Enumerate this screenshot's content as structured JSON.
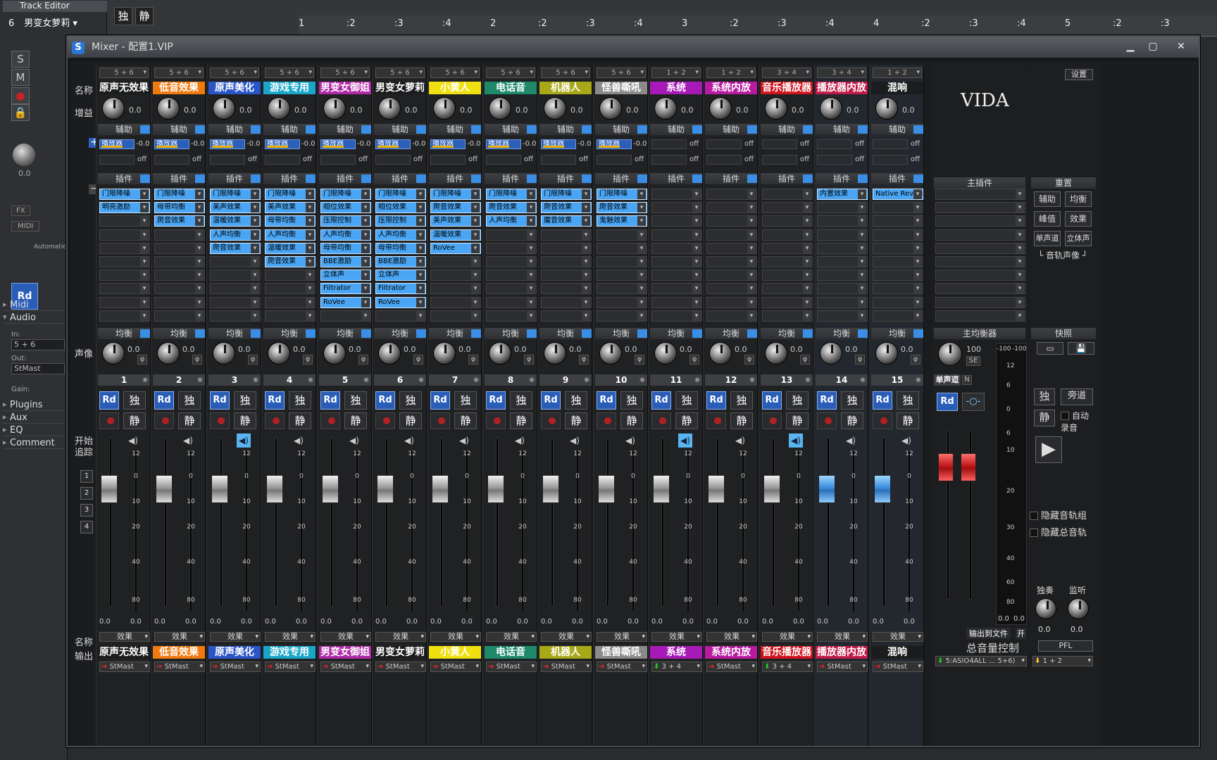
{
  "track_editor": {
    "title": "Track Editor",
    "track_num": "6",
    "track_name": "男变女萝莉",
    "solo": "独",
    "mute": "静"
  },
  "ruler": {
    "ticks": [
      "1",
      ":2",
      ":3",
      ":4",
      "2",
      ":2",
      ":3",
      ":4",
      "3",
      ":2",
      ":3",
      ":4",
      "4",
      ":2",
      ":3",
      ":4",
      "5",
      ":2",
      ":3"
    ]
  },
  "left_panel": {
    "btn_s": "S",
    "btn_m": "M",
    "knob_value": "0.0",
    "fx": "FX",
    "midi": "MIDI",
    "automation": "Automation",
    "rd": "Rd",
    "sections": [
      "Midi",
      "Audio",
      "Plugins",
      "Aux",
      "EQ",
      "Comment"
    ],
    "in_label": "In:",
    "in_value": "5 + 6",
    "out_label": "Out:",
    "out_value": "StMast",
    "gain_label": "Gain:"
  },
  "mixer": {
    "title": "Mixer - 配置1.VIP",
    "row_labels": {
      "name": "名称",
      "gain": "增益",
      "pan": "声像",
      "start": "开始",
      "track": "追踪",
      "name2": "名称",
      "output": "输出"
    },
    "section_labels": {
      "aux": "辅助",
      "insert": "插件",
      "eq": "均衡",
      "fx": "效果",
      "off": "off"
    },
    "track_btns": [
      "1",
      "2",
      "3",
      "4"
    ],
    "channels": [
      {
        "num": "1",
        "route": "5 + 6",
        "name": "原声无效果",
        "color": "#1b1c1e",
        "gain": "0.0",
        "pan": "0.0",
        "send": "播放器",
        "send_val": "-0.0",
        "inserts": [
          "门限降噪",
          "明亮激励"
        ],
        "speaker_on": false,
        "fader": 0.62,
        "output": "StMast",
        "out_arrow": "red"
      },
      {
        "num": "2",
        "route": "5 + 6",
        "name": "低音效果",
        "color": "#f07a10",
        "gain": "0.0",
        "pan": "0.0",
        "send": "播放器",
        "send_val": "-0.0",
        "inserts": [
          "门限降噪",
          "母带均衡",
          "爬音效果"
        ],
        "speaker_on": false,
        "fader": 0.62,
        "output": "StMast",
        "out_arrow": "red"
      },
      {
        "num": "3",
        "route": "5 + 6",
        "name": "原声美化",
        "color": "#2a56c8",
        "gain": "0.0",
        "pan": "0.0",
        "send": "播放器",
        "send_val": "-0.0",
        "inserts": [
          "门限降噪",
          "美声效果",
          "温暖效果",
          "人声均衡",
          "爬音效果"
        ],
        "speaker_on": true,
        "fader": 0.62,
        "output": "StMast",
        "out_arrow": "red"
      },
      {
        "num": "4",
        "route": "5 + 6",
        "name": "游戏专用",
        "color": "#1aa6c8",
        "gain": "0.0",
        "pan": "0.0",
        "send": "播放器",
        "send_val": "-0.0",
        "inserts": [
          "门限降噪",
          "美声效果",
          "母带均衡",
          "人声均衡",
          "温暖效果",
          "爬音效果"
        ],
        "speaker_on": false,
        "fader": 0.62,
        "output": "StMast",
        "out_arrow": "red"
      },
      {
        "num": "5",
        "route": "5 + 6",
        "name": "男变女御姐",
        "color": "#b02aa8",
        "gain": "0.0",
        "pan": "0.0",
        "send": "播放器",
        "send_val": "-0.0",
        "inserts": [
          "门限降噪",
          "相位效果",
          "压限控制",
          "人声均衡",
          "母带均衡",
          "BBE激励",
          "立体声",
          "Filtrator",
          "RoVee"
        ],
        "speaker_on": false,
        "fader": 0.62,
        "output": "StMast",
        "out_arrow": "red"
      },
      {
        "num": "6",
        "route": "5 + 6",
        "name": "男变女萝莉",
        "color": "#1b1c1e",
        "gain": "0.0",
        "pan": "0.0",
        "send": "播放器",
        "send_val": "-0.0",
        "inserts": [
          "门限降噪",
          "相位效果",
          "压限控制",
          "人声均衡",
          "母带均衡",
          "BBE激励",
          "立体声",
          "Filtrator",
          "RoVee"
        ],
        "speaker_on": false,
        "fader": 0.62,
        "output": "StMast",
        "out_arrow": "red"
      },
      {
        "num": "7",
        "route": "5 + 6",
        "name": "小黄人",
        "color": "#f0e010",
        "gain": "0.0",
        "pan": "0.0",
        "send": "播放器",
        "send_val": "-0.0",
        "inserts": [
          "门限降噪",
          "爬音效果",
          "美声效果",
          "温暖效果",
          "RoVee"
        ],
        "speaker_on": false,
        "fader": 0.62,
        "output": "StMast",
        "out_arrow": "red"
      },
      {
        "num": "8",
        "route": "5 + 6",
        "name": "电话音",
        "color": "#1e8a6a",
        "gain": "0.0",
        "pan": "0.0",
        "send": "播放器",
        "send_val": "-0.0",
        "inserts": [
          "门限降噪",
          "爬音效果",
          "人声均衡"
        ],
        "speaker_on": false,
        "fader": 0.62,
        "output": "StMast",
        "out_arrow": "red"
      },
      {
        "num": "9",
        "route": "5 + 6",
        "name": "机器人",
        "color": "#a8a818",
        "gain": "0.0",
        "pan": "0.0",
        "send": "播放器",
        "send_val": "-0.0",
        "inserts": [
          "门限降噪",
          "爬音效果",
          "魔音效果"
        ],
        "speaker_on": false,
        "fader": 0.62,
        "output": "StMast",
        "out_arrow": "red"
      },
      {
        "num": "10",
        "route": "5 + 6",
        "name": "怪兽嘶吼",
        "color": "#8a8a8a",
        "gain": "0.0",
        "pan": "0.0",
        "send": "播放器",
        "send_val": "-0.0",
        "inserts": [
          "门限降噪",
          "爬音效果",
          "鬼魅效果"
        ],
        "speaker_on": false,
        "fader": 0.62,
        "output": "StMast",
        "out_arrow": "red"
      },
      {
        "num": "11",
        "route": "1 + 2",
        "name": "系统",
        "color": "#a81ab8",
        "gain": "0.0",
        "pan": "0.0",
        "send": "",
        "send_val": "off",
        "inserts": [],
        "speaker_on": true,
        "fader": 0.62,
        "output": "3 + 4",
        "out_arrow": "green"
      },
      {
        "num": "12",
        "route": "1 + 2",
        "name": "系统内放",
        "color": "#b81aa0",
        "gain": "0.0",
        "pan": "0.0",
        "send": "",
        "send_val": "off",
        "inserts": [],
        "speaker_on": false,
        "fader": 0.62,
        "output": "StMast",
        "out_arrow": "red"
      },
      {
        "num": "13",
        "route": "3 + 4",
        "name": "音乐播放器",
        "color": "#d0141e",
        "gain": "0.0",
        "pan": "0.0",
        "send": "",
        "send_val": "off",
        "inserts": [],
        "speaker_on": true,
        "fader": 0.62,
        "output": "3 + 4",
        "out_arrow": "green"
      },
      {
        "num": "14",
        "route": "3 + 4",
        "name": "播放器内放",
        "color": "#c01a4a",
        "gain": "0.0",
        "pan": "0.0",
        "send": "",
        "send_val": "off",
        "inserts": [
          "内置效果"
        ],
        "speaker_on": false,
        "fader": 0.62,
        "output": "StMast",
        "out_arrow": "red",
        "selected": true
      },
      {
        "num": "15",
        "route": "1 + 2",
        "name": "混响",
        "color": "#1b1c1e",
        "gain": "0.0",
        "pan": "0.0",
        "send": "",
        "send_val": "off",
        "inserts": [
          "Native Reverb"
        ],
        "speaker_on": false,
        "fader": 0.62,
        "output": "StMast",
        "out_arrow": "red",
        "selected": true
      }
    ],
    "master": {
      "brand": "VIDA",
      "settings": "设置",
      "main_plugins": "主插件",
      "main_eq": "主均衡器",
      "pan": "100",
      "se": "SE",
      "mono": "单声道",
      "n": "N",
      "rd": "Rd",
      "meter_top": [
        "-100",
        "-100"
      ],
      "meter_ticks": [
        "12",
        "6",
        "0",
        "6",
        "10",
        "20",
        "30",
        "40",
        "60",
        "80"
      ],
      "meter_vals": [
        "0.0",
        "0.0"
      ],
      "export": "输出到文件",
      "export_toggle": "开",
      "total_label": "总音量控制",
      "output": "5:ASIO4ALL ... 5+6)"
    },
    "right": {
      "reset": "重置",
      "aux": "辅助",
      "eq": "均衡",
      "peak": "峰值",
      "fx": "效果",
      "mono": "单声道",
      "stereo": "立体声",
      "track_pan": "音轨声像",
      "snapshot": "快照",
      "solo": "独",
      "bypass": "旁道",
      "mute": "静",
      "auto_rec": "自动录音",
      "hide_groups": "隐藏音轨组",
      "hide_master": "隐藏总音轨",
      "solo_knob": "独奏",
      "monitor_knob": "监听",
      "solo_val": "0.0",
      "monitor_val": "0.0",
      "pfl": "PFL",
      "out": "1 + 2"
    },
    "meter_ticks": [
      "12",
      "0",
      "10",
      "20",
      "40",
      "80"
    ],
    "meter_val": "0.0"
  }
}
